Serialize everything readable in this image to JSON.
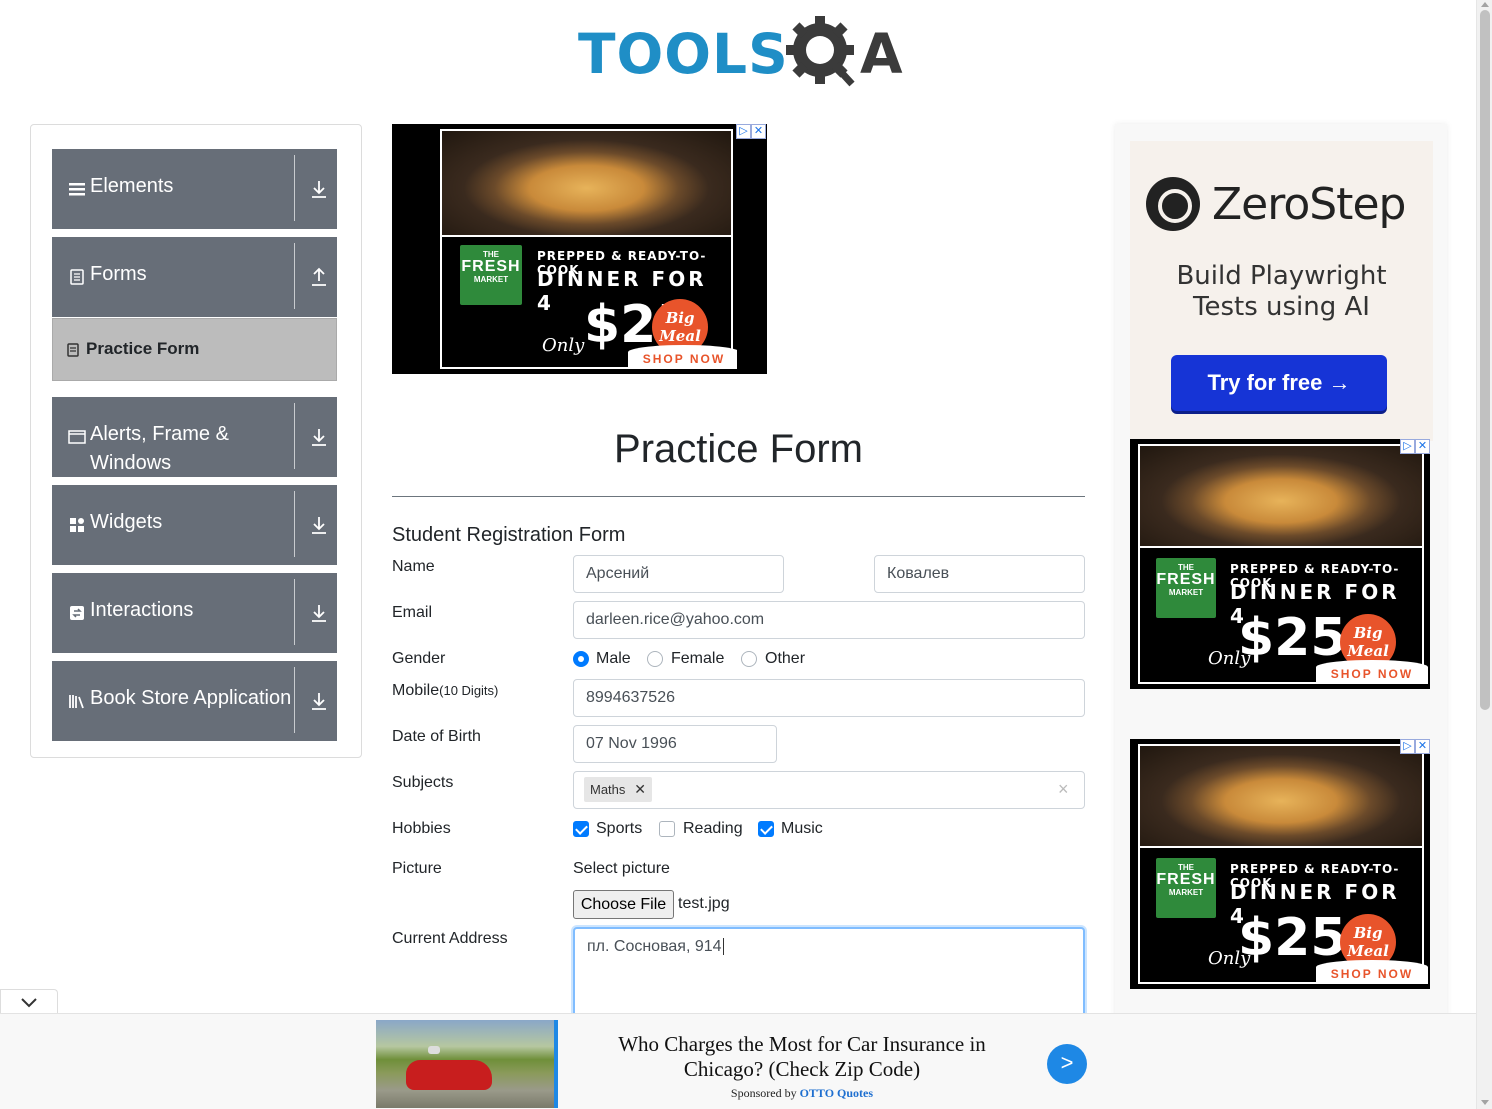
{
  "header": {
    "logo_main": "TOOLS",
    "logo_end": "A"
  },
  "sidebar": {
    "groups": [
      {
        "label": "Elements",
        "icon": "hamburger-icon"
      },
      {
        "label": "Forms",
        "icon": "document-icon"
      },
      {
        "label": "Alerts, Frame &",
        "label2": "Windows",
        "icon": "window-icon"
      },
      {
        "label": "Widgets",
        "icon": "widgets-icon"
      },
      {
        "label": "Interactions",
        "icon": "interactions-icon"
      },
      {
        "label": "Book Store Application",
        "icon": "books-icon"
      }
    ],
    "active_item": "Practice Form"
  },
  "food_ad": {
    "brand_the": "THE",
    "brand_fresh": "FRESH",
    "brand_market": "MARKET",
    "line1": "PREPPED & READY-TO-COOK",
    "line2": "DINNER FOR 4",
    "only": "Only",
    "price": "$25",
    "badge": "Big Meal",
    "cta": "SHOP NOW"
  },
  "form": {
    "page_title": "Practice Form",
    "subtitle": "Student Registration Form",
    "name_label": "Name",
    "first_name": "Арсений",
    "last_name": "Ковалев",
    "email_label": "Email",
    "email": "darleen.rice@yahoo.com",
    "gender_label": "Gender",
    "gender_options": [
      "Male",
      "Female",
      "Other"
    ],
    "gender_selected": "Male",
    "mobile_label": "Mobile",
    "mobile_hint": "(10 Digits)",
    "mobile": "8994637526",
    "dob_label": "Date of Birth",
    "dob": "07 Nov 1996",
    "subjects_label": "Subjects",
    "subject_tag": "Maths",
    "hobbies_label": "Hobbies",
    "hobbies": [
      {
        "label": "Sports",
        "checked": true
      },
      {
        "label": "Reading",
        "checked": false
      },
      {
        "label": "Music",
        "checked": true
      }
    ],
    "picture_label": "Picture",
    "picture_prompt": "Select picture",
    "choose_file": "Choose File",
    "file_name": "test.jpg",
    "address_label": "Current Address",
    "address": "пл. Сосновая, 914"
  },
  "zerostep_ad": {
    "brand": "ZeroStep",
    "tagline1": "Build Playwright",
    "tagline2": "Tests using AI",
    "cta": "Try for free →"
  },
  "bottom_ad": {
    "title": "Who Charges the Most for Car Insurance in Chicago? (Check Zip Code)",
    "sponsored_prefix": "Sponsored by",
    "sponsor": "OTTO Quotes",
    "go": ">"
  },
  "colors": {
    "sidebar_group": "#676e78",
    "accent": "#007bff",
    "logo": "#1f8ec6"
  }
}
